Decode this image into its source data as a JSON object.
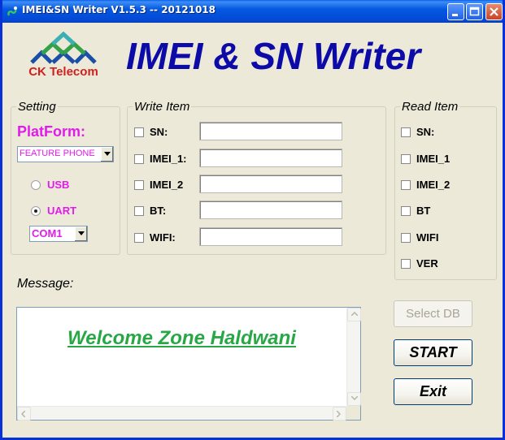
{
  "window": {
    "title": "IMEI&SN Writer V1.5.3 -- 20121018"
  },
  "header": {
    "logo_text": "CK Telecom",
    "app_title": "IMEI & SN Writer"
  },
  "setting": {
    "group_label": "Setting",
    "platform_label": "PlatForm:",
    "platform_value": "FEATURE PHONE",
    "usb_label": "USB",
    "uart_label": "UART",
    "selected_mode": "UART",
    "com_value": "COM1"
  },
  "write_item": {
    "group_label": "Write Item",
    "fields": [
      {
        "label": "SN:",
        "value": "",
        "checked": false
      },
      {
        "label": "IMEI_1:",
        "value": "",
        "checked": false
      },
      {
        "label": "IMEI_2",
        "value": "",
        "checked": false
      },
      {
        "label": "BT:",
        "value": "",
        "checked": false
      },
      {
        "label": "WIFI:",
        "value": "",
        "checked": false
      }
    ]
  },
  "read_item": {
    "group_label": "Read Item",
    "items": [
      {
        "label": "SN:",
        "checked": false
      },
      {
        "label": "IMEI_1",
        "checked": false
      },
      {
        "label": "IMEI_2",
        "checked": false
      },
      {
        "label": "BT",
        "checked": false
      },
      {
        "label": "WIFI",
        "checked": false
      },
      {
        "label": "VER",
        "checked": false
      }
    ]
  },
  "message": {
    "label": "Message:",
    "text": "Welcome Zone Haldwani"
  },
  "buttons": {
    "select_db": "Select DB",
    "start": "START",
    "exit": "Exit"
  },
  "colors": {
    "title_blue": "#0D0BA8",
    "magenta": "#E21BEA",
    "message_green": "#28A745",
    "logo_red": "#D2201E"
  }
}
